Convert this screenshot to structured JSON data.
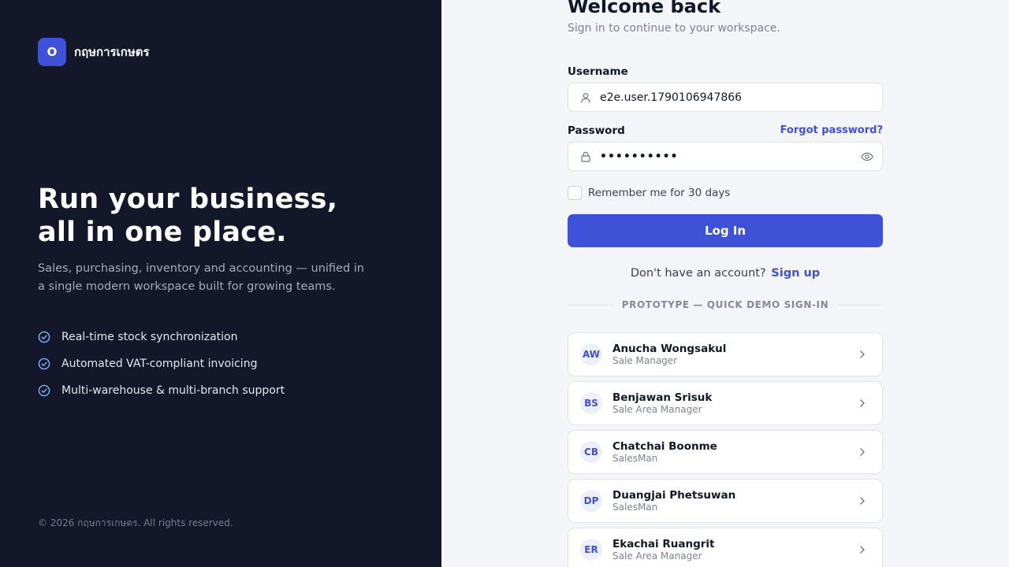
{
  "brand": {
    "mark": "O",
    "name": "กฤษการเกษตร"
  },
  "hero": {
    "headline_line1": "Run your business,",
    "headline_line2": "all in one place.",
    "description": "Sales, purchasing, inventory and accounting — unified in a single modern workspace built for growing teams."
  },
  "features": [
    {
      "text": "Real-time stock synchronization",
      "icon": "check-circle-icon"
    },
    {
      "text": "Automated VAT-compliant invoicing",
      "icon": "check-circle-icon"
    },
    {
      "text": "Multi-warehouse & multi-branch support",
      "icon": "check-circle-icon"
    }
  ],
  "footer": "© 2026 กฤษการเกษตร. All rights reserved.",
  "login": {
    "title": "Welcome back",
    "subtitle": "Sign in to continue to your workspace.",
    "username_label": "Username",
    "username_value": "e2e.user.1790106947866",
    "password_label": "Password",
    "forgot_label": "Forgot password?",
    "password_value": "••••••••••",
    "remember_label": "Remember me for 30 days",
    "submit_label": "Log In",
    "signup_prompt": "Don't have an account?",
    "signup_link": "Sign up",
    "demo_divider": "PROTOTYPE — QUICK DEMO SIGN-IN"
  },
  "demo_users": [
    {
      "initials": "AW",
      "name": "Anucha Wongsakul",
      "role": "Sale Manager"
    },
    {
      "initials": "BS",
      "name": "Benjawan Srisuk",
      "role": "Sale Area Manager"
    },
    {
      "initials": "CB",
      "name": "Chatchai Boonme",
      "role": "SalesMan"
    },
    {
      "initials": "DP",
      "name": "Duangjai Phetsuwan",
      "role": "SalesMan"
    },
    {
      "initials": "ER",
      "name": "Ekachai Ruangrit",
      "role": "Sale Area Manager"
    }
  ],
  "colors": {
    "left_panel_bg": "#131729",
    "accent": "#3f51d7",
    "page_bg": "#f4f5f9",
    "feature_check": "#7fb6ff"
  }
}
